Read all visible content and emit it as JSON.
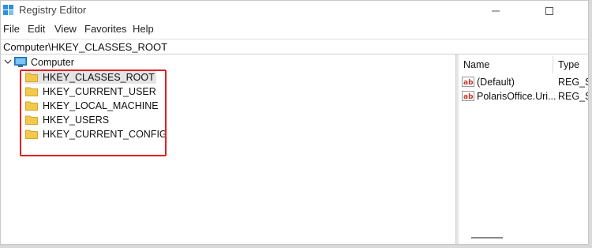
{
  "window": {
    "title": "Registry Editor"
  },
  "menu": [
    "File",
    "Edit",
    "View",
    "Favorites",
    "Help"
  ],
  "address": "Computer\\HKEY_CLASSES_ROOT",
  "tree": {
    "root": "Computer",
    "children": [
      "HKEY_CLASSES_ROOT",
      "HKEY_CURRENT_USER",
      "HKEY_LOCAL_MACHINE",
      "HKEY_USERS",
      "HKEY_CURRENT_CONFIG"
    ],
    "selected": "HKEY_CLASSES_ROOT"
  },
  "values": {
    "headers": {
      "name": "Name",
      "type": "Type"
    },
    "rows": [
      {
        "name": "(Default)",
        "type": "REG_SZ"
      },
      {
        "name": "PolarisOffice.Uri...",
        "type": "REG_SZ"
      }
    ]
  },
  "colors": {
    "highlight": "#e02020",
    "folder": "#f2c94c",
    "computer": "#2f8fd8"
  },
  "icons": [
    "registry-icon",
    "minimize-icon",
    "maximize-icon",
    "chevron-down-icon",
    "computer-icon",
    "folder-icon",
    "string-value-icon"
  ]
}
